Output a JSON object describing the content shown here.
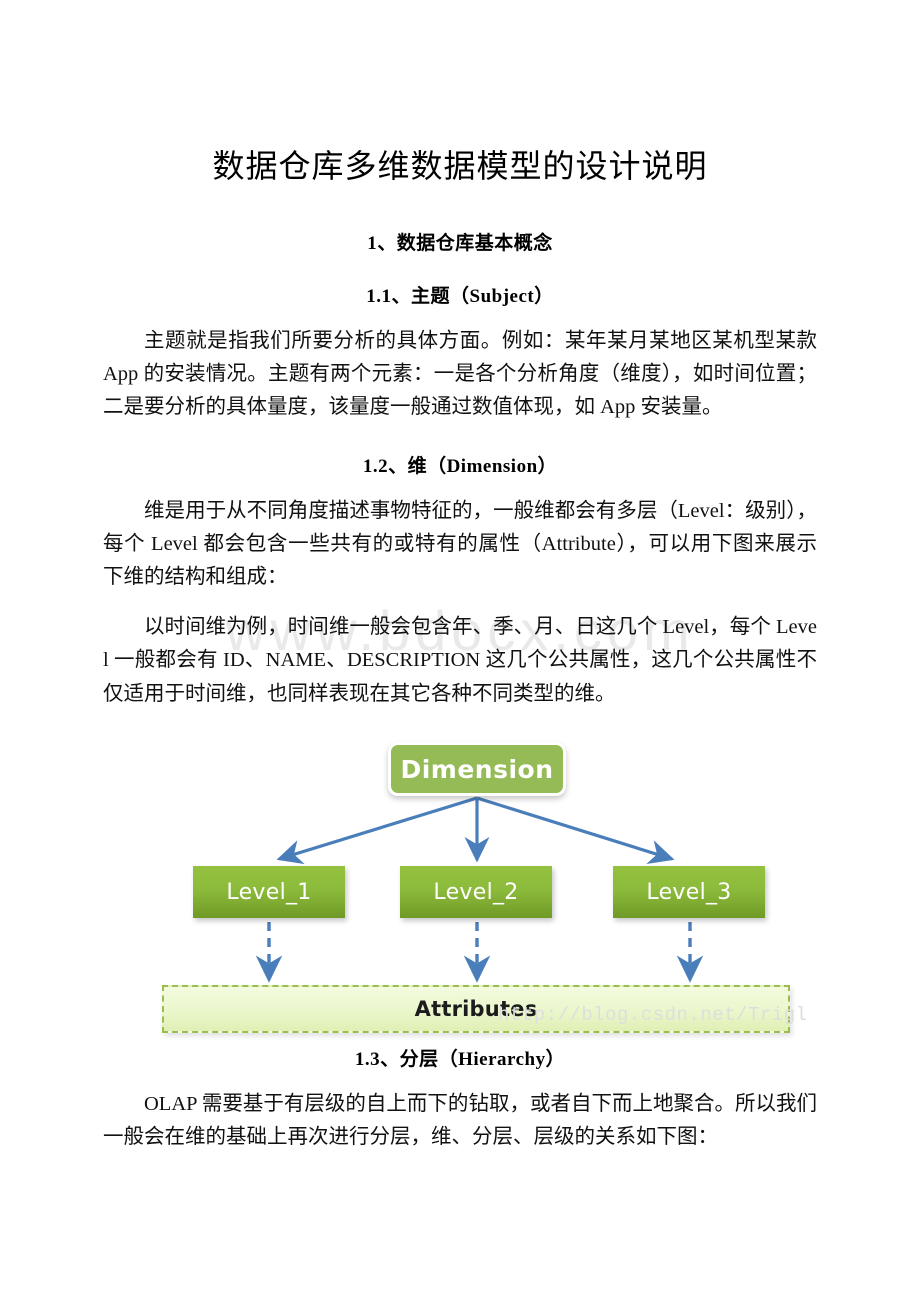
{
  "document": {
    "title": "数据仓库多维数据模型的设计说明",
    "section1": {
      "heading": "1、数据仓库基本概念",
      "sub1": {
        "heading": "1.1、主题（Subject）",
        "paragraph": "主题就是指我们所要分析的具体方面。例如：某年某月某地区某机型某款 App 的安装情况。主题有两个元素：一是各个分析角度（维度），如时间位置；二是要分析的具体量度，该量度一般通过数值体现，如 App 安装量。"
      },
      "sub2": {
        "heading": "1.2、维（Dimension）",
        "paragraph1": "维是用于从不同角度描述事物特征的，一般维都会有多层（Level：级别），每个 Level 都会包含一些共有的或特有的属性（Attribute），可以用下图来展示下维的结构和组成：",
        "paragraph2": "以时间维为例，时间维一般会包含年、季、月、日这几个 Level，每个 Level 一般都会有 ID、NAME、DESCRIPTION 这几个公共属性，这几个公共属性不仅适用于时间维，也同样表现在其它各种不同类型的维。"
      },
      "sub3": {
        "heading": "1.3、分层（Hierarchy）",
        "paragraph": "OLAP 需要基于有层级的自上而下的钻取，或者自下而上地聚合。所以我们一般会在维的基础上再次进行分层，维、分层、层级的关系如下图："
      }
    }
  },
  "diagram": {
    "root": {
      "label": "Dimension",
      "color": "#95bb56"
    },
    "levels": [
      {
        "label": "Level_1"
      },
      {
        "label": "Level_2"
      },
      {
        "label": "Level_3"
      }
    ],
    "attributes": {
      "label": "Attributes",
      "border_color": "#9bbc50",
      "fill_color": "#eaf7cc"
    },
    "arrow_color": "#4a7ebb"
  },
  "watermarks": {
    "center": "www.bdocx.com",
    "diagram": "http://blog.csdn.net/Trigl"
  }
}
